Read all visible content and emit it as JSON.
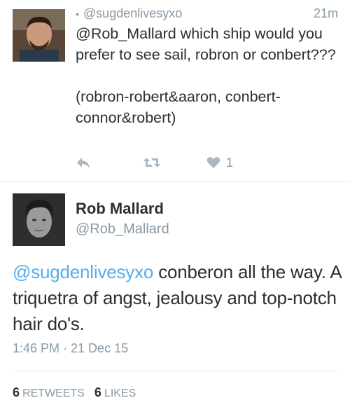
{
  "reply_tweet": {
    "handle": "@sugdenlivesyxo",
    "time": "21m",
    "text": "@Rob_Mallard which ship would you prefer to see sail, robron or conbert???\n\n(robron-robert&aaron, conbert-connor&robert)",
    "like_count": "1",
    "icons": [
      "reply-icon",
      "retweet-icon",
      "heart-icon"
    ]
  },
  "main_tweet": {
    "name": "Rob Mallard",
    "handle": "@Rob_Mallard",
    "mention": "@sugdenlivesyxo",
    "text_rest": " conberon all the way. A triquetra of angst, jealousy and top-notch hair do's.",
    "timestamp": "1:46 PM · 21 Dec 15",
    "retweets_count": "6",
    "retweets_label": "RETWEETS",
    "likes_count": "6",
    "likes_label": "LIKES"
  },
  "colors": {
    "link": "#55acee",
    "text": "#292f33",
    "muted": "#8899a6",
    "icon": "#aab8c2",
    "divider": "#e1e8ed"
  }
}
